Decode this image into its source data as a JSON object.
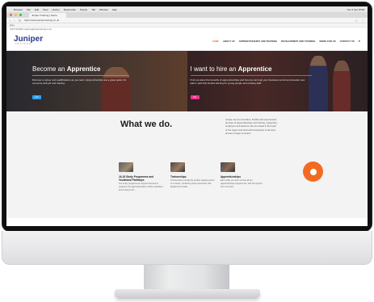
{
  "browser": {
    "menu": [
      "Browser",
      "File",
      "Edit",
      "View",
      "History",
      "Bookmarks",
      "People",
      "Tab",
      "Window",
      "Help"
    ],
    "status_right": "Tue 3 Jan  15:09",
    "tab_title": "Juniper Training | Home",
    "url": "https://www.junipertraining.co.uk",
    "bookmarks": "Apps"
  },
  "site": {
    "topstrip": "01473 921800   enquiries@junipertraining.co.uk",
    "logo_main": "Juniper",
    "logo_sub": "TRAINING",
    "nav": [
      "HOME",
      "ABOUT US",
      "APPRENTICESHIPS AND TRAINING",
      "DEVELOPMENT AND TRAINING",
      "WORK FOR US",
      "CONTACT US"
    ],
    "accent": "#f26b22",
    "brand": "#2a3a88"
  },
  "hero": {
    "left_title_pre": "Become an ",
    "left_title_bold": "Apprentice",
    "left_text": "Discover a career and qualifications as you learn. Apprenticeships are a great option for everyone with job and training.",
    "left_btn": "GO",
    "right_title_pre": "I want to hire an ",
    "right_title_bold": "Apprentice",
    "right_text": "Find out about the benefits of apprenticeships and how we can help your business recruit and develop new talent, with fully funded training for young people and existing staff.",
    "right_btn": "GO"
  },
  "content": {
    "heading": "What we do.",
    "about": "Juniper are an innovative, flexible and experienced provider of apprenticeships and training, supporting employers and learners. We are based in the heart of the region and work with businesses of all sizes across a range of sectors.",
    "services": [
      {
        "title": "16-18 Study Programme and Vocational Pathways",
        "text": "Our study programmes support learners to progress into apprenticeships, further education and employment."
      },
      {
        "title": "Traineeships",
        "text": "Traineeships provide the perfect stepping stone to a career, combining work experience with English and maths."
      },
      {
        "title": "Apprenticeships",
        "text": "Earn while you learn across all our apprenticeship programmes, with full support from our team."
      }
    ]
  }
}
